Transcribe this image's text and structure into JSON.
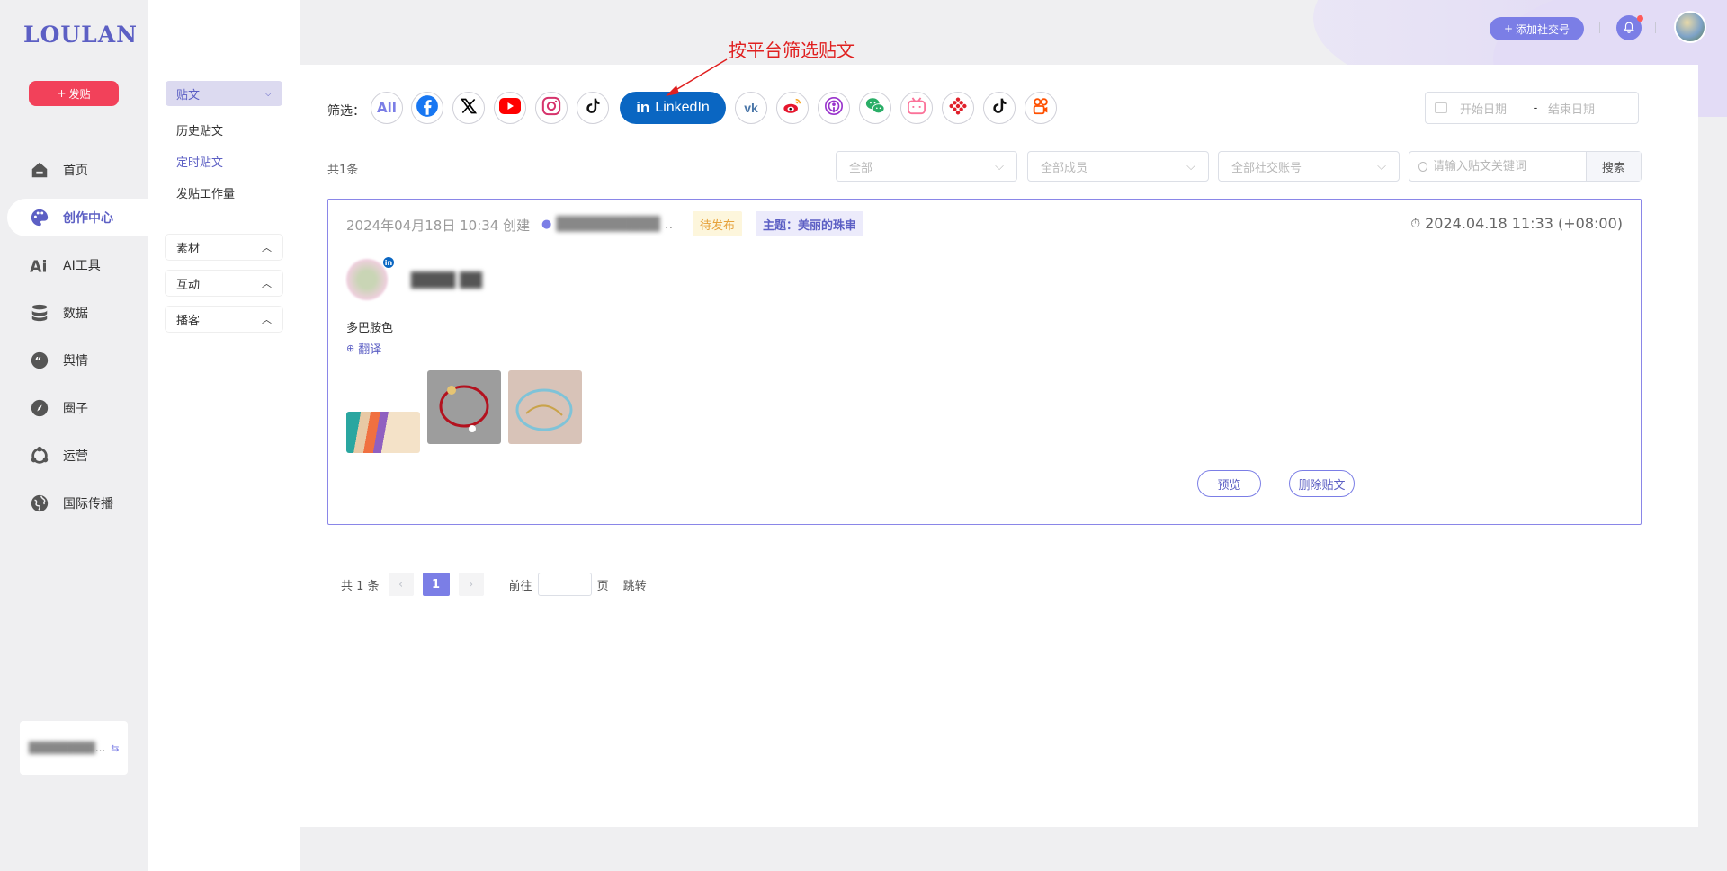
{
  "app": {
    "logo": "LOULAN",
    "post_button": "发贴"
  },
  "nav": {
    "items": [
      {
        "label": "首页",
        "icon": "home-icon"
      },
      {
        "label": "创作中心",
        "icon": "palette-icon",
        "active": true
      },
      {
        "label": "AI工具",
        "icon": "ai-icon"
      },
      {
        "label": "数据",
        "icon": "database-icon"
      },
      {
        "label": "舆情",
        "icon": "quote-icon"
      },
      {
        "label": "圈子",
        "icon": "compass-icon"
      },
      {
        "label": "运营",
        "icon": "operations-icon"
      },
      {
        "label": "国际传播",
        "icon": "globe-icon"
      }
    ],
    "account_switch": "..."
  },
  "subnav": {
    "post_group": "贴文",
    "links": [
      "历史贴文",
      "定时贴文",
      "发贴工作量"
    ],
    "active_link": "定时贴文",
    "groups": [
      "素材",
      "互动",
      "播客"
    ]
  },
  "topbar": {
    "add_account": "添加社交号"
  },
  "filter": {
    "label": "筛选：",
    "all": "All",
    "selected": "LinkedIn",
    "platforms": [
      "facebook",
      "x",
      "youtube",
      "instagram",
      "tiktok",
      "linkedin",
      "vk",
      "weibo",
      "podcast",
      "wechat",
      "bilibili",
      "kuaishou-red",
      "tiktok-2",
      "kuaishou"
    ],
    "date_start_placeholder": "开始日期",
    "date_sep": "-",
    "date_end_placeholder": "结束日期"
  },
  "list": {
    "count": "共1条",
    "select_all": "全部",
    "select_members": "全部成员",
    "select_accounts": "全部社交账号",
    "search_placeholder": "请输入贴文关键词",
    "search_button": "搜索"
  },
  "post": {
    "created": "2024年04月18日 10:34 创建",
    "author": "..",
    "status": "待发布",
    "topic": "主题：美丽的珠串",
    "scheduled": "2024.04.18 11:33 (+08:00)",
    "account_name": "",
    "text": "多巴胺色",
    "translate": "翻译",
    "preview": "预览",
    "delete": "删除贴文"
  },
  "pagination": {
    "total": "共 1 条",
    "current": "1",
    "goto_prefix": "前往",
    "goto_suffix": "页",
    "jump": "跳转"
  },
  "annotation": "按平台筛选贴文",
  "colors": {
    "accent": "#7b7ee6",
    "linkedin": "#0a66c2",
    "post_button": "#f2415a",
    "annotation": "#e02020"
  }
}
